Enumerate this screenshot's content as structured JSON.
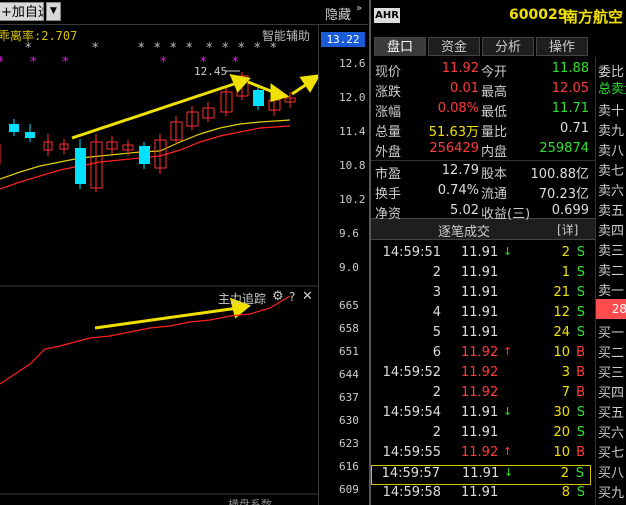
{
  "toolbar": {
    "add_favorite": "+加自选",
    "dropdown": "▼",
    "hide": "隐藏",
    "collapse": "»"
  },
  "chart": {
    "deviation_label": "乖离率:2.707",
    "smart_assist": "智能辅助",
    "current_price_tag": "13.22",
    "peak_annotation": "12.45",
    "price_scale": [
      "12.6",
      "12.0",
      "11.4",
      "10.8",
      "10.2",
      "9.6",
      "9.0"
    ],
    "indicator_title": "主力追踪",
    "indicator_scale": [
      "665",
      "658",
      "651",
      "644",
      "637",
      "630",
      "623",
      "616",
      "609"
    ],
    "bottom_label": "横盘系数",
    "colors": {
      "up": "#ff3030",
      "down": "#00e0ff",
      "arrow": "#f0e000",
      "ma_short": "#e0d000",
      "ma_long": "#ff2020"
    }
  },
  "stock": {
    "badge": "AHR",
    "code": "600029",
    "name": "南方航空"
  },
  "tabs": [
    {
      "label": "盘口",
      "active": true
    },
    {
      "label": "资金",
      "active": false
    },
    {
      "label": "分析",
      "active": false
    },
    {
      "label": "操作",
      "active": false
    }
  ],
  "quote": [
    {
      "l1": "现价",
      "v1": "11.92",
      "c1": "red",
      "l2": "今开",
      "v2": "11.88",
      "c2": "green"
    },
    {
      "l1": "涨跌",
      "v1": "0.01",
      "c1": "red",
      "l2": "最高",
      "v2": "12.05",
      "c2": "red"
    },
    {
      "l1": "涨幅",
      "v1": "0.08%",
      "c1": "red",
      "l2": "最低",
      "v2": "11.71",
      "c2": "green"
    },
    {
      "l1": "总量",
      "v1": "51.63万",
      "c1": "yellow",
      "l2": "量比",
      "v2": "0.71",
      "c2": "white"
    },
    {
      "l1": "外盘",
      "v1": "256429",
      "c1": "red",
      "l2": "内盘",
      "v2": "259874",
      "c2": "green"
    },
    {
      "l1": "市盈",
      "v1": "12.79",
      "c1": "white",
      "l2": "股本",
      "v2": "100.88亿",
      "c2": "white"
    },
    {
      "l1": "换手",
      "v1": "0.74%",
      "c1": "white",
      "l2": "流通",
      "v2": "70.23亿",
      "c2": "white"
    },
    {
      "l1": "净资",
      "v1": "5.02",
      "c1": "white",
      "l2": "收益(三)",
      "v2": "0.699",
      "c2": "white"
    }
  ],
  "ticks_header": {
    "title": "逐笔成交",
    "detail": "[详]"
  },
  "ticks": [
    {
      "time": "14:59:51",
      "price": "11.91",
      "pc": "white",
      "arrow": "↓",
      "ac": "green",
      "vol": "2",
      "dir": "S",
      "dc": "green"
    },
    {
      "time": "2",
      "price": "11.91",
      "pc": "white",
      "arrow": "",
      "ac": "green",
      "vol": "1",
      "dir": "S",
      "dc": "green"
    },
    {
      "time": "3",
      "price": "11.91",
      "pc": "white",
      "arrow": "",
      "ac": "green",
      "vol": "21",
      "dir": "S",
      "dc": "green"
    },
    {
      "time": "4",
      "price": "11.91",
      "pc": "white",
      "arrow": "",
      "ac": "green",
      "vol": "12",
      "dir": "S",
      "dc": "green"
    },
    {
      "time": "5",
      "price": "11.91",
      "pc": "white",
      "arrow": "",
      "ac": "green",
      "vol": "24",
      "dir": "S",
      "dc": "green"
    },
    {
      "time": "6",
      "price": "11.92",
      "pc": "red",
      "arrow": "↑",
      "ac": "red",
      "vol": "10",
      "dir": "B",
      "dc": "red"
    },
    {
      "time": "14:59:52",
      "price": "11.92",
      "pc": "red",
      "arrow": "",
      "ac": "red",
      "vol": "3",
      "dir": "B",
      "dc": "red"
    },
    {
      "time": "2",
      "price": "11.92",
      "pc": "red",
      "arrow": "",
      "ac": "red",
      "vol": "7",
      "dir": "B",
      "dc": "red"
    },
    {
      "time": "14:59:54",
      "price": "11.91",
      "pc": "white",
      "arrow": "↓",
      "ac": "green",
      "vol": "30",
      "dir": "S",
      "dc": "green"
    },
    {
      "time": "2",
      "price": "11.91",
      "pc": "white",
      "arrow": "",
      "ac": "green",
      "vol": "20",
      "dir": "S",
      "dc": "green"
    },
    {
      "time": "14:59:55",
      "price": "11.92",
      "pc": "red",
      "arrow": "↑",
      "ac": "red",
      "vol": "10",
      "dir": "B",
      "dc": "red"
    },
    {
      "time": "14:59:57",
      "price": "11.91",
      "pc": "white",
      "arrow": "↓",
      "ac": "green",
      "vol": "2",
      "dir": "S",
      "dc": "green",
      "selected": true
    },
    {
      "time": "14:59:58",
      "price": "11.91",
      "pc": "white",
      "arrow": "",
      "ac": "green",
      "vol": "8",
      "dir": "S",
      "dc": "green"
    }
  ],
  "book": {
    "header_label": "委比",
    "total_label": "总卖量",
    "sell_labels": [
      "卖十",
      "卖九",
      "卖八",
      "卖七",
      "卖六",
      "卖五",
      "卖四",
      "卖三",
      "卖二",
      "卖一"
    ],
    "mid_value": "28",
    "buy_labels": [
      "买一",
      "买二",
      "买三",
      "买四",
      "买五",
      "买六",
      "买七",
      "买八",
      "买九"
    ]
  }
}
